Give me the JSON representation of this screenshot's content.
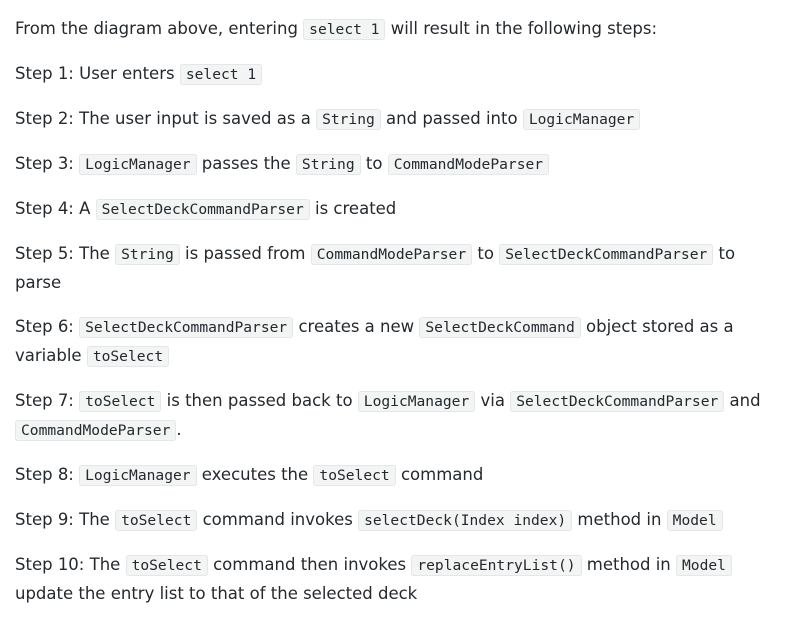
{
  "intro": {
    "t1": "From the diagram above, entering ",
    "c1": "select 1",
    "t2": " will result in the following steps:"
  },
  "steps": [
    {
      "label": "Step 1: ",
      "t1": "User enters ",
      "c1": "select 1"
    },
    {
      "label": "Step 2: ",
      "t1": "The user input is saved as a ",
      "c1": "String",
      "t2": " and passed into ",
      "c2": "LogicManager"
    },
    {
      "label": "Step 3: ",
      "c1": "LogicManager",
      "t1": " passes the ",
      "c2": "String",
      "t2": " to ",
      "c3": "CommandModeParser"
    },
    {
      "label": "Step 4: ",
      "t1": "A ",
      "c1": "SelectDeckCommandParser",
      "t2": " is created"
    },
    {
      "label": "Step 5: ",
      "t1": "The ",
      "c1": "String",
      "t2": " is passed from ",
      "c2": "CommandModeParser",
      "t3": " to ",
      "c3": "SelectDeckCommandParser",
      "t4": " to parse"
    },
    {
      "label": "Step 6: ",
      "c1": "SelectDeckCommandParser",
      "t1": " creates a new ",
      "c2": "SelectDeckCommand",
      "t2": " object stored as a variable ",
      "c3": "toSelect"
    },
    {
      "label": "Step 7: ",
      "c1": "toSelect",
      "t1": " is then passed back to ",
      "c2": "LogicManager",
      "t2": " via ",
      "c3": "SelectDeckCommandParser",
      "t3": " and ",
      "c4": "CommandModeParser",
      "t4": "."
    },
    {
      "label": "Step 8: ",
      "c1": "LogicManager",
      "t1": " executes the ",
      "c2": "toSelect",
      "t2": " command"
    },
    {
      "label": "Step 9: ",
      "t1": "The ",
      "c1": "toSelect",
      "t2": " command invokes ",
      "c2": "selectDeck(Index index)",
      "t3": " method in ",
      "c3": "Model"
    },
    {
      "label": "Step 10: ",
      "t1": "The ",
      "c1": "toSelect",
      "t2": " command then invokes ",
      "c2": "replaceEntryList()",
      "t3": " method in ",
      "c3": "Model",
      "t4": " update the entry list to that of the selected deck"
    }
  ]
}
